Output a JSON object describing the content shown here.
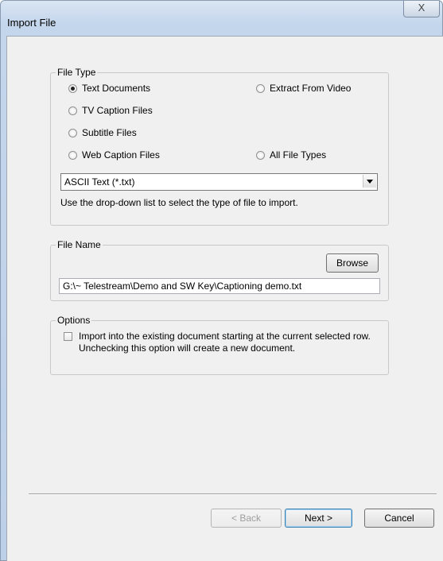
{
  "window": {
    "title": "Import File",
    "close_label": "X"
  },
  "file_type": {
    "legend": "File Type",
    "options": [
      {
        "label": "Text Documents",
        "checked": true
      },
      {
        "label": "Extract From Video",
        "checked": false
      },
      {
        "label": "TV Caption Files",
        "checked": false
      },
      {
        "label": "Subtitle Files",
        "checked": false
      },
      {
        "label": "Web Caption Files",
        "checked": false
      },
      {
        "label": "All File Types",
        "checked": false
      }
    ],
    "format_selected": "ASCII Text (*.txt)",
    "hint": "Use the drop-down list to select the type of file to import."
  },
  "file_name": {
    "legend": "File Name",
    "browse_label": "Browse",
    "path": "G:\\~ Telestream\\Demo and SW Key\\Captioning demo.txt"
  },
  "options": {
    "legend": "Options",
    "import_existing_label_line1": "Import into the existing document starting at the current selected row.",
    "import_existing_label_line2": "Unchecking this option will create a new document.",
    "import_existing_checked": false
  },
  "footer": {
    "back_label": "< Back",
    "next_label": "Next >",
    "cancel_label": "Cancel"
  }
}
